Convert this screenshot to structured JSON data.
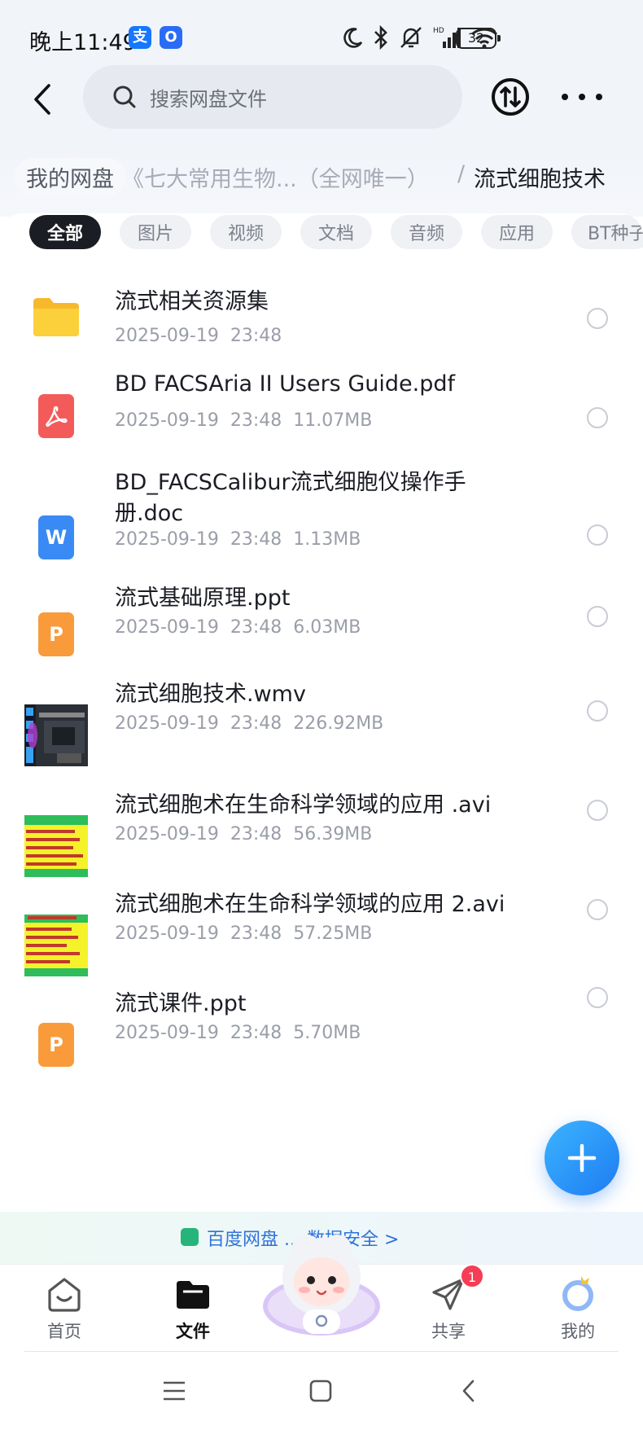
{
  "status_bar": {
    "time": "晚上11:49",
    "app_badge_1": "支",
    "app_badge_2": "O",
    "battery": "32"
  },
  "header": {
    "search_placeholder": "搜索网盘文件"
  },
  "breadcrumb": {
    "root": "我的网盘",
    "middle": "《七大常用生物...（全网唯一）",
    "separator": "/",
    "current": "流式细胞技术"
  },
  "filters": [
    "全部",
    "图片",
    "视频",
    "文档",
    "音频",
    "应用",
    "BT种子"
  ],
  "files": [
    {
      "name": "流式相关资源集",
      "meta": "2025-09-19  23:48",
      "icon": "folder-icon"
    },
    {
      "name": "BD FACSAria II Users Guide.pdf",
      "meta": "2025-09-19  23:48  11.07MB",
      "icon": "pdf-icon"
    },
    {
      "name": "BD_FACSCalibur流式细胞仪操作手册.doc",
      "meta": "2025-09-19  23:48  1.13MB",
      "icon": "word-doc-icon"
    },
    {
      "name": "流式基础原理.ppt",
      "meta": "2025-09-19  23:48  6.03MB",
      "icon": "ppt-icon"
    },
    {
      "name": "流式细胞技术.wmv",
      "meta": "2025-09-19  23:48  226.92MB",
      "icon": "video-thumbnail"
    },
    {
      "name": "流式细胞术在生命科学领域的应用 .avi",
      "meta": "2025-09-19  23:48  56.39MB",
      "icon": "video-thumbnail"
    },
    {
      "name": "流式细胞术在生命科学领域的应用 2.avi",
      "meta": "2025-09-19  23:48  57.25MB",
      "icon": "video-thumbnail"
    },
    {
      "name": "流式课件.ppt",
      "meta": "2025-09-19  23:48  5.70MB",
      "icon": "ppt-icon"
    }
  ],
  "promo": {
    "text": "百度网盘 ... 数据安全 >"
  },
  "bottom_nav": {
    "home": "首页",
    "files": "文件",
    "share": "共享",
    "share_badge": "1",
    "me": "我的"
  },
  "colors": {
    "accent": "#1e7cf2",
    "badge": "#f53d56",
    "folder": "#fcc933",
    "pdf": "#f35a5a",
    "word": "#3a8af5",
    "ppt": "#f99b3a"
  }
}
